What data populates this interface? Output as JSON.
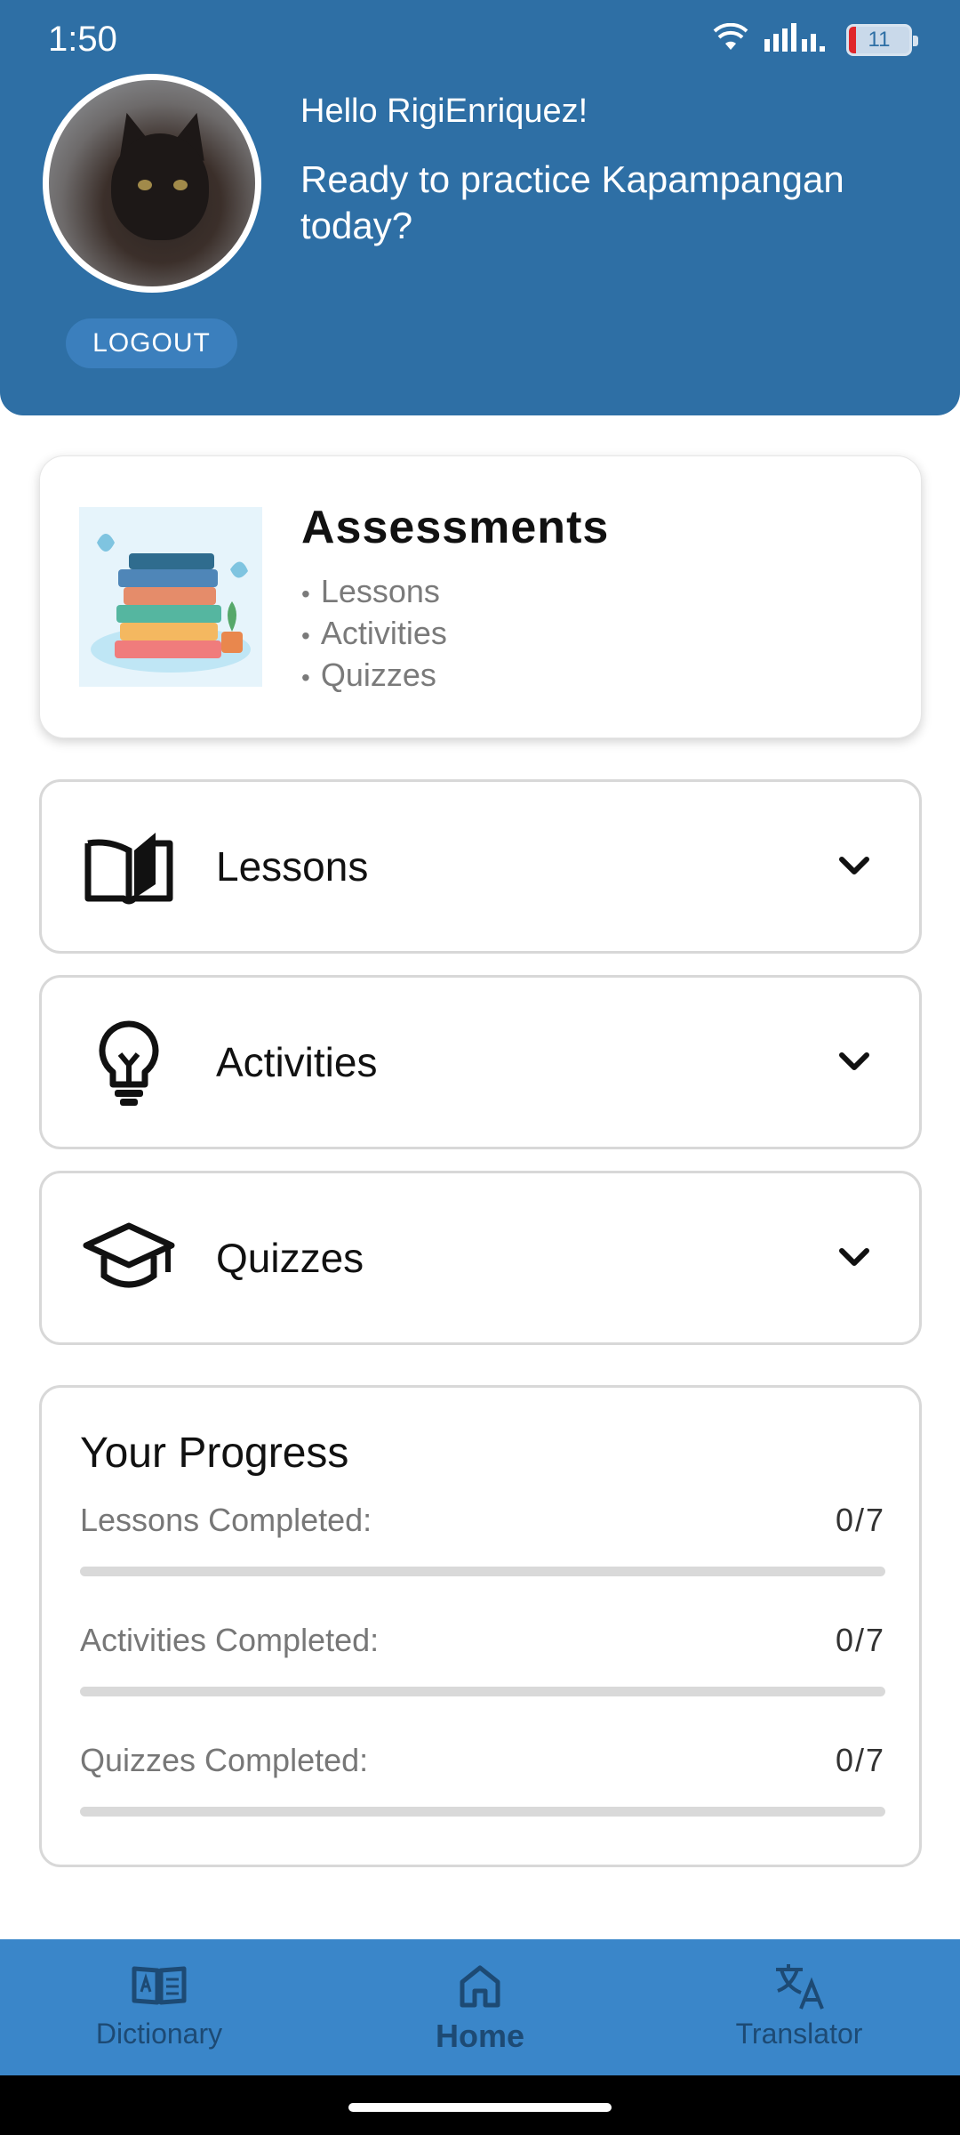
{
  "status_bar": {
    "time": "1:50",
    "battery": "11"
  },
  "header": {
    "greeting": "Hello RigiEnriquez!",
    "subtitle": "Ready to practice Kapampangan today?",
    "logout_label": "LOGOUT"
  },
  "assessments": {
    "title": "Assessments",
    "items": [
      "Lessons",
      "Activities",
      "Quizzes"
    ]
  },
  "sections": [
    {
      "label": "Lessons",
      "icon": "book-open-icon"
    },
    {
      "label": "Activities",
      "icon": "lightbulb-icon"
    },
    {
      "label": "Quizzes",
      "icon": "graduation-cap-icon"
    }
  ],
  "progress": {
    "title": "Your Progress",
    "items": [
      {
        "label": "Lessons Completed:",
        "value": "0/7",
        "fraction": 0
      },
      {
        "label": "Activities Completed:",
        "value": "0/7",
        "fraction": 0
      },
      {
        "label": "Quizzes Completed:",
        "value": "0/7",
        "fraction": 0
      }
    ]
  },
  "bottom_nav": [
    {
      "label": "Dictionary",
      "icon": "dictionary-icon",
      "active": false
    },
    {
      "label": "Home",
      "icon": "home-icon",
      "active": true
    },
    {
      "label": "Translator",
      "icon": "translate-icon",
      "active": false
    }
  ],
  "colors": {
    "header": "#2e6fa5",
    "nav": "#3a86c9",
    "nav_text": "#1d4a74"
  }
}
